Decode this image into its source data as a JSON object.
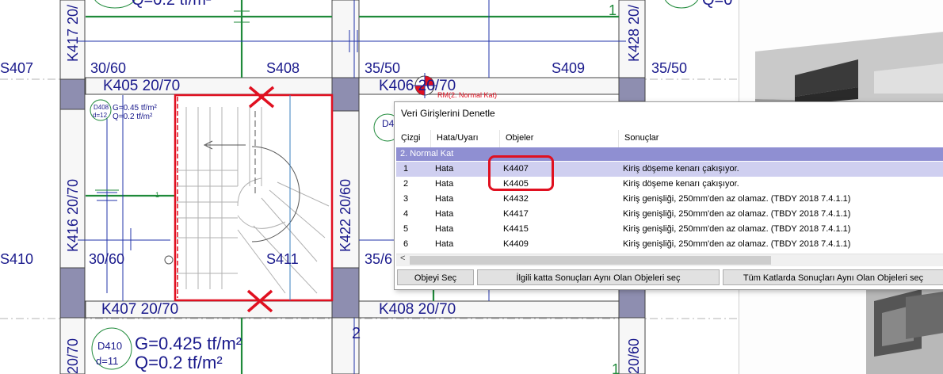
{
  "drawing": {
    "slabs": {
      "s407": "S407",
      "s408": "S408",
      "s409": "S409",
      "s410": "S410",
      "s411": "S411"
    },
    "beams": {
      "k405": "K405 20/70",
      "k406": "K406 20/70",
      "k407": "K407 20/70",
      "k408": "K408 20/70",
      "k416": "K416 20/70",
      "k417": "K417 20/",
      "k422": "K422 20/60",
      "k428": "K428 20/",
      "bottom_left": "20/70",
      "bottom_right": "20/60"
    },
    "columns": {
      "c1": "30/60",
      "c2": "35/50",
      "c3": "35/50",
      "c4": "30/60",
      "c5": "35/6"
    },
    "load_labels": {
      "top_left": "Q=0.2 tf/m²",
      "top_right": "Q=0",
      "mid_g": "G=0.45 tf/m²",
      "mid_q": "Q=0.2 tf/m²",
      "mid_tag": "D408",
      "mid_d": "d=12",
      "stair_tag": "D4",
      "bottom_tag": "D410",
      "bottom_d": "d=11",
      "bottom_g": "G=0.425 tf/m²",
      "bottom_q": "Q=0.2 tf/m²"
    },
    "marker_label": "RM(2. Normal Kat)",
    "axis_numbers": {
      "a1": "1",
      "a2": "1",
      "a3": "1",
      "a4": "1",
      "a5": "2"
    },
    "colors": {
      "beam_text": "#1a1a8c",
      "beam_outline": "#444444",
      "column_fill": "#8e8eb0",
      "axis_green": "#1f8a3a",
      "dim_blue": "#2233aa",
      "error_red": "#e01020",
      "stair_grey": "#b0b0b0"
    }
  },
  "dialog": {
    "title": "Veri Girişlerini Denetle",
    "columns": [
      "Çizgi",
      "Hata/Uyarı",
      "Objeler",
      "Sonuçlar"
    ],
    "group": "2. Normal Kat",
    "rows": [
      {
        "line": "1",
        "type": "Hata",
        "object": "K4407",
        "result": "Kiriş döşeme kenarı çakışıyor."
      },
      {
        "line": "2",
        "type": "Hata",
        "object": "K4405",
        "result": "Kiriş döşeme kenarı çakışıyor."
      },
      {
        "line": "3",
        "type": "Hata",
        "object": "K4432",
        "result": "Kiriş genişliği, 250mm'den az olamaz. (TBDY 2018 7.4.1.1)"
      },
      {
        "line": "4",
        "type": "Hata",
        "object": "K4417",
        "result": "Kiriş genişliği, 250mm'den az olamaz. (TBDY 2018 7.4.1.1)"
      },
      {
        "line": "5",
        "type": "Hata",
        "object": "K4415",
        "result": "Kiriş genişliği, 250mm'den az olamaz. (TBDY 2018 7.4.1.1)"
      },
      {
        "line": "6",
        "type": "Hata",
        "object": "K4409",
        "result": "Kiriş genişliği, 250mm'den az olamaz. (TBDY 2018 7.4.1.1)"
      }
    ],
    "buttons": {
      "select_object": "Objeyi Seç",
      "select_same_floor": "İlgili katta Sonuçları Aynı Olan Objeleri seç",
      "select_all_floors": "Tüm Katlarda Sonuçları Aynı Olan Objeleri seç"
    },
    "scroll_left_glyph": "<"
  }
}
